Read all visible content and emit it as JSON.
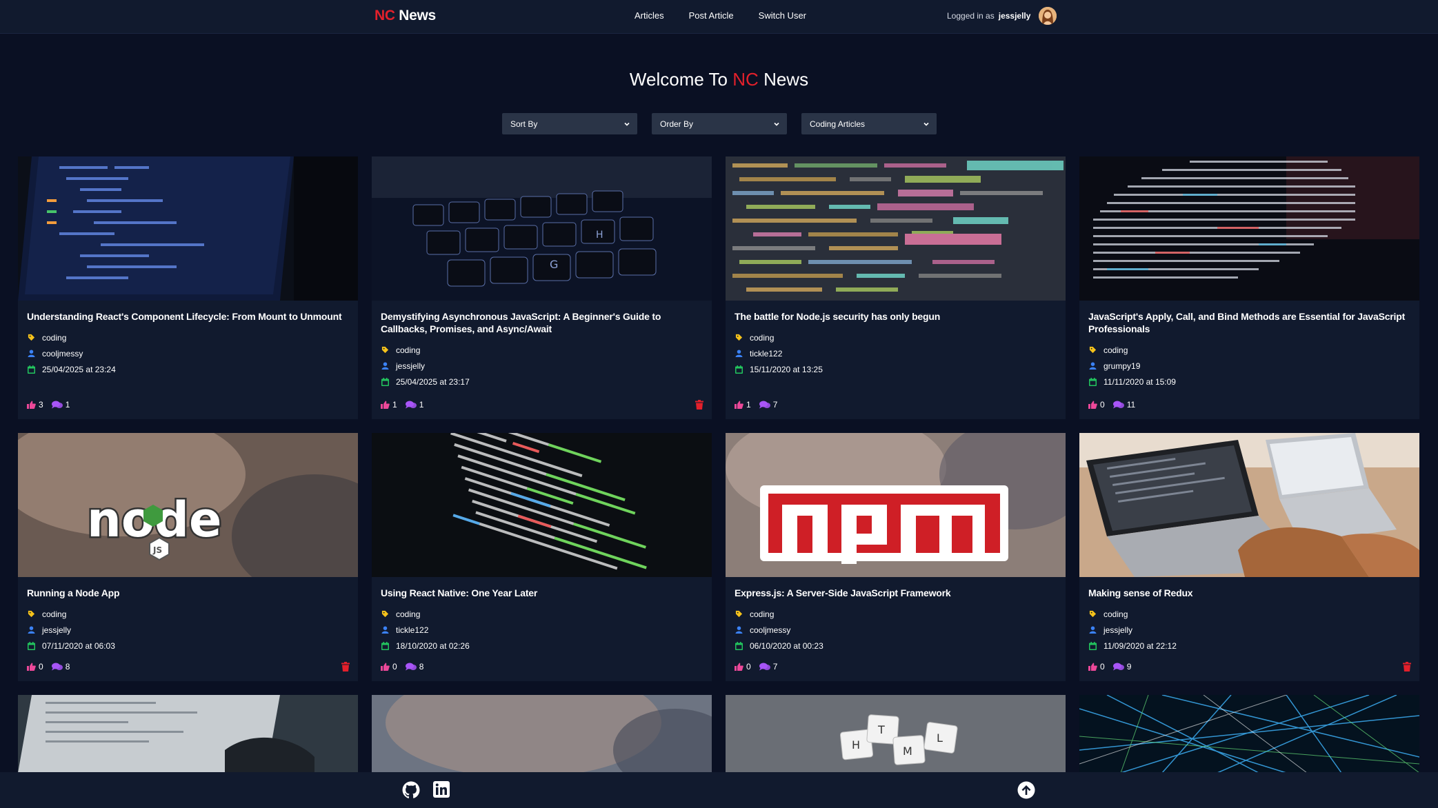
{
  "nav": {
    "brand_nc": "NC",
    "brand_news": "News",
    "links": [
      "Articles",
      "Post Article",
      "Switch User"
    ],
    "logged_in_label": "Logged in as",
    "username": "jessjelly"
  },
  "heading": {
    "prefix": "Welcome To",
    "nc": "NC",
    "suffix": "News"
  },
  "filters": {
    "sort_by": "Sort By",
    "order_by": "Order By",
    "topic": "Coding Articles"
  },
  "articles": [
    {
      "title": "Understanding React's Component Lifecycle: From Mount to Unmount",
      "topic": "coding",
      "author": "cooljmessy",
      "date": "25/04/2025 at 23:24",
      "votes": "3",
      "comments": "1",
      "deletable": false,
      "image": "code-laptop-blue"
    },
    {
      "title": "Demystifying Asynchronous JavaScript: A Beginner's Guide to Callbacks, Promises, and Async/Await",
      "topic": "coding",
      "author": "jessjelly",
      "date": "25/04/2025 at 23:17",
      "votes": "1",
      "comments": "1",
      "deletable": true,
      "image": "backlit-keyboard"
    },
    {
      "title": "The battle for Node.js security has only begun",
      "topic": "coding",
      "author": "tickle122",
      "date": "15/11/2020 at 13:25",
      "votes": "1",
      "comments": "7",
      "deletable": false,
      "image": "colorful-code-blur"
    },
    {
      "title": "JavaScript's Apply, Call, and Bind Methods are Essential for JavaScript Professionals",
      "topic": "coding",
      "author": "grumpy19",
      "date": "11/11/2020 at 15:09",
      "votes": "0",
      "comments": "11",
      "deletable": false,
      "image": "dark-code-screen"
    },
    {
      "title": "Running a Node App",
      "topic": "coding",
      "author": "jessjelly",
      "date": "07/11/2020 at 06:03",
      "votes": "0",
      "comments": "8",
      "deletable": true,
      "image": "node-js-logo"
    },
    {
      "title": "Using React Native: One Year Later",
      "topic": "coding",
      "author": "tickle122",
      "date": "18/10/2020 at 02:26",
      "votes": "0",
      "comments": "8",
      "deletable": false,
      "image": "green-code-screen"
    },
    {
      "title": "Express.js: A Server-Side JavaScript Framework",
      "topic": "coding",
      "author": "cooljmessy",
      "date": "06/10/2020 at 00:23",
      "votes": "0",
      "comments": "7",
      "deletable": false,
      "image": "npm-logo"
    },
    {
      "title": "Making sense of Redux",
      "topic": "coding",
      "author": "jessjelly",
      "date": "11/09/2020 at 22:12",
      "votes": "0",
      "comments": "9",
      "deletable": true,
      "image": "laptop-on-desk"
    }
  ],
  "partial_cards": [
    "laptop-typing",
    "blurred-person",
    "html-scrabble-tiles",
    "network-lines"
  ],
  "colors": {
    "background": "#0a1023",
    "card": "#111a2e",
    "brand_red": "#e3202b",
    "topic_icon": "#f5c21b",
    "author_icon": "#3b82f6",
    "date_icon": "#22c55e",
    "vote_icon": "#ec4899",
    "comment_icon": "#a855f7",
    "delete": "#e3202b"
  }
}
